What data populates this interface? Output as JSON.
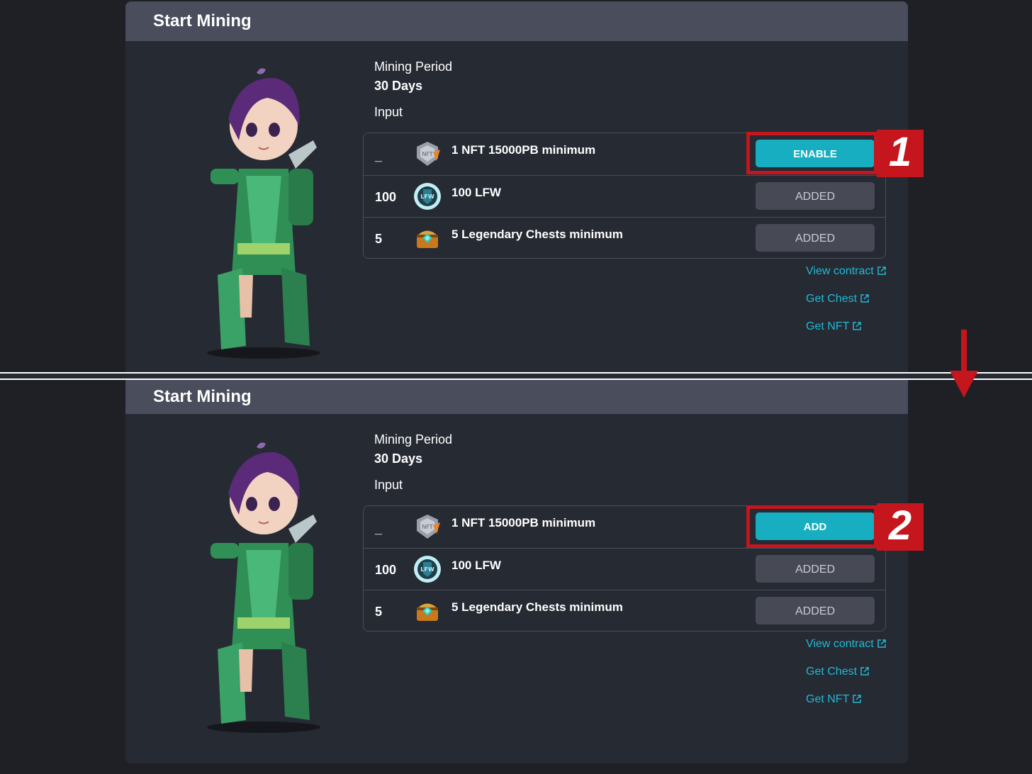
{
  "colors": {
    "background": "#1e2026",
    "panel": "#262a33",
    "header": "#4a4d5c",
    "accent": "#16aec0",
    "link": "#22b9d3",
    "annotation": "#c4161c"
  },
  "panels": [
    {
      "title": "Start Mining",
      "mining_period_label": "Mining Period",
      "mining_period_value": "30 Days",
      "input_label": "Input",
      "rows": [
        {
          "qty": "_",
          "icon": "nft-badge-icon",
          "desc": "1 NFT 15000PB minimum",
          "button": "ENABLE",
          "state": "primary"
        },
        {
          "qty": "100",
          "icon": "lfw-coin-icon",
          "desc": "100 LFW",
          "button": "ADDED",
          "state": "disabled"
        },
        {
          "qty": "5",
          "icon": "legendary-chest-icon",
          "desc": "5 Legendary Chests minimum",
          "button": "ADDED",
          "state": "disabled"
        }
      ],
      "links": [
        "View contract",
        "Get Chest",
        "Get NFT"
      ],
      "step": "1"
    },
    {
      "title": "Start Mining",
      "mining_period_label": "Mining Period",
      "mining_period_value": "30 Days",
      "input_label": "Input",
      "rows": [
        {
          "qty": "_",
          "icon": "nft-badge-icon",
          "desc": "1 NFT 15000PB minimum",
          "button": "ADD",
          "state": "primary"
        },
        {
          "qty": "100",
          "icon": "lfw-coin-icon",
          "desc": "100 LFW",
          "button": "ADDED",
          "state": "disabled"
        },
        {
          "qty": "5",
          "icon": "legendary-chest-icon",
          "desc": "5 Legendary Chests minimum",
          "button": "ADDED",
          "state": "disabled"
        }
      ],
      "links": [
        "View contract",
        "Get Chest",
        "Get NFT"
      ],
      "step": "2"
    }
  ]
}
